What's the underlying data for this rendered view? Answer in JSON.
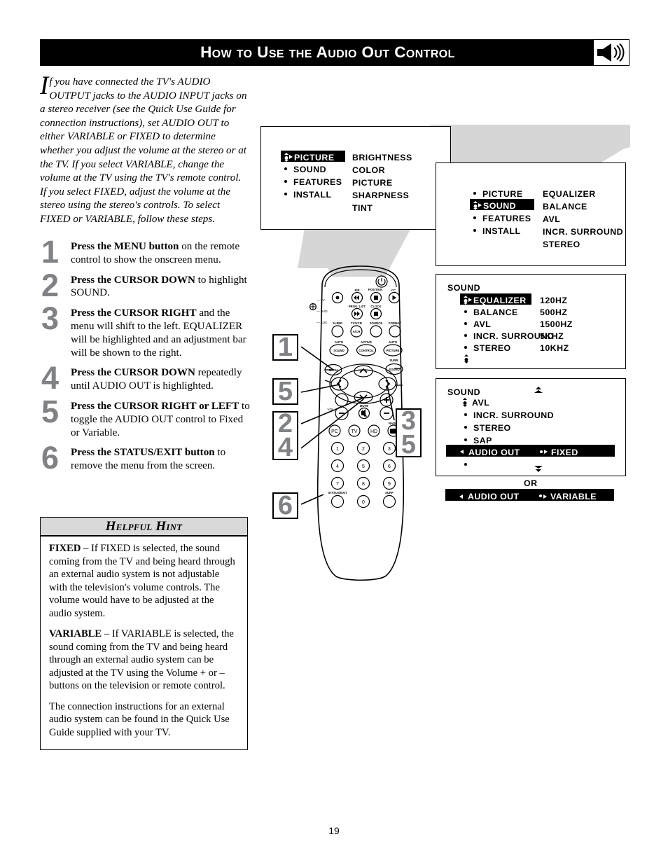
{
  "header": {
    "title": "How to Use the Audio Out Control",
    "icon": "speaker-volume-icon"
  },
  "intro": {
    "dropcap": "I",
    "text": "f you have connected the TV's AUDIO OUTPUT jacks to the AUDIO INPUT jacks on a stereo receiver (see the Quick Use Guide for connection instructions), set AUDIO OUT to either VARIABLE or FIXED to determine whether you adjust the volume at the stereo or at the TV.  If you select VARIABLE, change the volume at the TV using the TV's remote control.  If you select FIXED, adjust the volume at the stereo using the stereo's controls. To select FIXED or VARIABLE, follow these steps."
  },
  "steps": [
    {
      "num": "1",
      "bold": "Press the MENU button",
      "rest": " on the remote control to show the onscreen menu."
    },
    {
      "num": "2",
      "bold": "Press the CURSOR DOWN",
      "rest": " to highlight SOUND."
    },
    {
      "num": "3",
      "bold": "Press the CURSOR RIGHT",
      "rest": " and the menu will shift to the left. EQUALIZER will be highlighted and an adjustment bar will be shown to the right."
    },
    {
      "num": "4",
      "bold": "Press the CURSOR DOWN",
      "rest": " repeatedly until AUDIO OUT is highlighted."
    },
    {
      "num": "5",
      "bold": "Press the CURSOR RIGHT or LEFT",
      "rest": " to toggle the AUDIO OUT control to Fixed or Variable."
    },
    {
      "num": "6",
      "bold": "Press the STATUS/EXIT button",
      "rest": " to remove the menu from the screen."
    }
  ],
  "hint": {
    "title": "Helpful Hint",
    "paragraphs": [
      {
        "bold": "FIXED",
        "rest": " – If FIXED is selected, the sound coming from the TV and being heard through an external audio system is not adjustable with the television's volume controls. The volume would have to be adjusted at the audio system."
      },
      {
        "bold": "VARIABLE",
        "rest": " – If VARIABLE is selected, the sound coming from the TV and being heard through an external audio system can be adjusted at the TV using the Volume + or – buttons on the television or remote control."
      },
      {
        "bold": "",
        "rest": "The connection instructions for an external audio system can be found in the Quick Use Guide supplied with your TV."
      }
    ]
  },
  "page_number": "19",
  "osd_screens": {
    "screen1": {
      "left_items": [
        "PICTURE",
        "SOUND",
        "FEATURES",
        "INSTALL"
      ],
      "highlighted": "PICTURE",
      "right_items": [
        "BRIGHTNESS",
        "COLOR",
        "PICTURE",
        "SHARPNESS",
        "TINT"
      ]
    },
    "screen2": {
      "left_items": [
        "PICTURE",
        "SOUND",
        "FEATURES",
        "INSTALL"
      ],
      "highlighted": "SOUND",
      "right_items": [
        "EQUALIZER",
        "BALANCE",
        "AVL",
        "INCR.  SURROUND",
        "STEREO"
      ]
    },
    "screen3": {
      "title": "SOUND",
      "left_items": [
        "EQUALIZER",
        "BALANCE",
        "AVL",
        "INCR.  SURROUND",
        "STEREO"
      ],
      "highlighted": "EQUALIZER",
      "right_items": [
        "120HZ",
        "500HZ",
        "1500HZ",
        "5KHZ",
        "10KHZ"
      ]
    },
    "screen4": {
      "title": "SOUND",
      "left_items": [
        "AVL",
        "INCR.  SURROUND",
        "STEREO",
        "SAP",
        "AUDIO  OUT"
      ],
      "highlighted": "AUDIO  OUT",
      "highlighted_value": "FIXED",
      "or_label": "OR",
      "alt_row_label": "AUDIO  OUT",
      "alt_row_value": "VARIABLE"
    }
  },
  "remote": {
    "labels": {
      "tv": "TV",
      "dvd": "DVD",
      "aux": "AUX",
      "pip": "PIP",
      "position": "POSITION",
      "cc": "CC",
      "prog_list": "PROG. LIST",
      "clock": "CLOCK",
      "sleep": "SLEEP",
      "tv_vcr": "TV/VCR",
      "source": "SOURCE",
      "format": "FORMAT",
      "a_ch": "A/CH",
      "auto_sound": "AUTO",
      "sound": "SOUND",
      "active": "ACTIVE",
      "control": "CONTROL",
      "auto_picture": "AUTO",
      "picture": "PICTURE",
      "menu": "MENU",
      "surr": "SURR.",
      "sound2": "SOUND",
      "vol": "VOL",
      "mute": "MUTE",
      "ch": "CH",
      "pc": "PC",
      "tv_btn": "TV",
      "hd": "HD",
      "radio": "RADIO",
      "status_exit": "STATUS/EXIT",
      "surf": "SURF",
      "keys": [
        "1",
        "2",
        "3",
        "4",
        "5",
        "6",
        "7",
        "8",
        "9",
        "0"
      ]
    }
  },
  "callouts": [
    {
      "id": "callout-1",
      "numbers": [
        "1"
      ]
    },
    {
      "id": "callout-5-left",
      "numbers": [
        "5"
      ]
    },
    {
      "id": "callout-2-4",
      "numbers": [
        "2",
        "4"
      ]
    },
    {
      "id": "callout-3-5",
      "numbers": [
        "3",
        "5"
      ]
    },
    {
      "id": "callout-6",
      "numbers": [
        "6"
      ]
    }
  ],
  "colors": {
    "number_gray": "#808285",
    "hint_header_gray": "#d9d9d9",
    "swoosh_gray": "#d6d6d6",
    "black": "#000000"
  }
}
